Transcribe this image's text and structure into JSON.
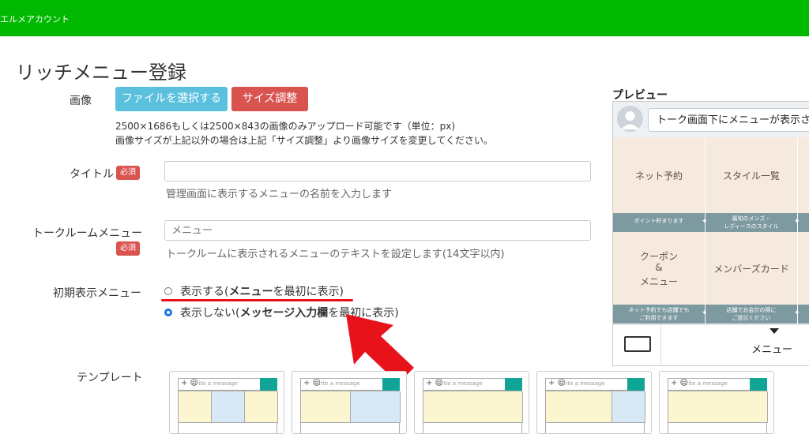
{
  "header": {
    "brand": "エルメアカウント",
    "bg_color": "#00b900"
  },
  "page": {
    "title": "リッチメニュー登録"
  },
  "form": {
    "image": {
      "label": "画像",
      "choose_file_button": "ファイルを選択する",
      "resize_button": "サイズ調整",
      "note_line1": "2500×1686もしくは2500×843の画像のみアップロード可能です（単位：px)",
      "note_line2": "画像サイズが上記以外の場合は上記「サイズ調整」より画像サイズを変更してください。"
    },
    "title": {
      "label": "タイトル",
      "required_badge": "必須",
      "value": "",
      "help": "管理画面に表示するメニューの名前を入力します"
    },
    "talkroom_menu": {
      "label": "トークルームメニュー",
      "required_badge": "必須",
      "placeholder": "メニュー",
      "help": "トークルームに表示されるメニューのテキストを設定します(14文字以内)"
    },
    "initial_display": {
      "label": "初期表示メニュー",
      "option_show_prefix": "表示する(",
      "option_show_bold": "メニュー",
      "option_show_suffix": "を最初に表示)",
      "option_hide_prefix": "表示しない(",
      "option_hide_bold": "メッセージ入力欄",
      "option_hide_suffix": "を最初に表示)",
      "selected": "hide"
    },
    "template": {
      "label": "テンプレート"
    }
  },
  "preview": {
    "title": "プレビュー",
    "bubble_text": "トーク画面下にメニューが表示さ",
    "cells": [
      {
        "title": "ネット予約",
        "band": "ポイント貯まります"
      },
      {
        "title": "スタイル一覧",
        "band1": "最旬のメンズ・",
        "band2": "レディースのスタイル"
      },
      {
        "title1": "クーポン",
        "title2": "&",
        "title3": "メニュー",
        "band1": "ネット予約でも店舗でも",
        "band2": "ご利用できます"
      },
      {
        "title": "メンバーズカード",
        "band1": "店舗でお会計の際に",
        "band2": "ご提示ください"
      }
    ],
    "menu_label": "メニュー"
  },
  "templates": [
    {
      "placeholder": "Write a message"
    },
    {
      "placeholder": "Write a message"
    },
    {
      "placeholder": "Write a message"
    },
    {
      "placeholder": "Write a message"
    },
    {
      "placeholder": "Write a message"
    }
  ],
  "colors": {
    "accent_blue": "#5bc0de",
    "danger_red": "#d9534f",
    "highlight_red": "#e8121a",
    "band_teal": "#7d9aa1"
  }
}
